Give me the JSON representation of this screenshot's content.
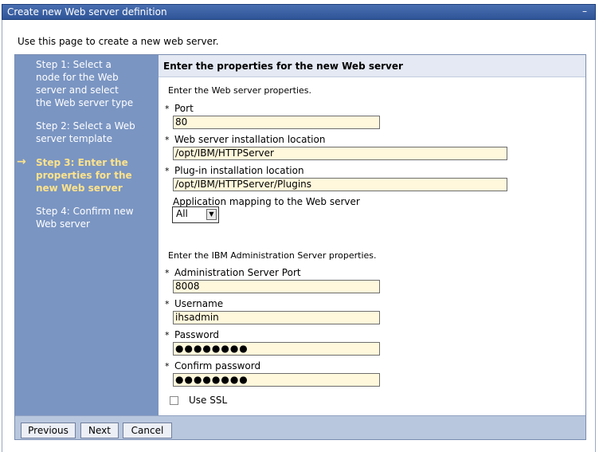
{
  "window": {
    "title": "Create new Web server definition",
    "minimize_glyph": "–"
  },
  "intro": "Use this page to create a new web server.",
  "steps": [
    {
      "label": "Step 1: Select a node for the Web server and select the Web server type",
      "current": false
    },
    {
      "label": "Step 2: Select a Web server template",
      "current": false
    },
    {
      "label": "Step 3: Enter the properties for the new Web server",
      "current": true
    },
    {
      "label": "Step 4: Confirm new Web server",
      "current": false
    }
  ],
  "current_step_icon": "arrow-right-icon",
  "main": {
    "header": "Enter the properties for the new Web server",
    "web_section": "Enter the Web server properties.",
    "admin_section": "Enter the IBM Administration Server properties.",
    "required_marker": "*",
    "fields": {
      "port": {
        "label": "Port",
        "value": "80"
      },
      "install_location": {
        "label": "Web server installation location",
        "value": "/opt/IBM/HTTPServer"
      },
      "plugin_location": {
        "label": "Plug-in installation location",
        "value": "/opt/IBM/HTTPServer/Plugins"
      },
      "app_mapping": {
        "label": "Application mapping to the Web server",
        "value": "All"
      },
      "admin_port": {
        "label": "Administration Server Port",
        "value": "8008"
      },
      "username": {
        "label": "Username",
        "value": "ihsadmin"
      },
      "password": {
        "label": "Password",
        "value": "●●●●●●●●"
      },
      "confirm_password": {
        "label": "Confirm password",
        "value": "●●●●●●●●"
      }
    },
    "use_ssl": {
      "label": "Use SSL",
      "checked": false
    }
  },
  "buttons": {
    "previous": "Previous",
    "next": "Next",
    "cancel": "Cancel"
  },
  "colors": {
    "title_bar": "#2f5598",
    "steps_panel": "#7a95c2",
    "current_step": "#ffe38a",
    "input_bg": "#fff8dc"
  }
}
